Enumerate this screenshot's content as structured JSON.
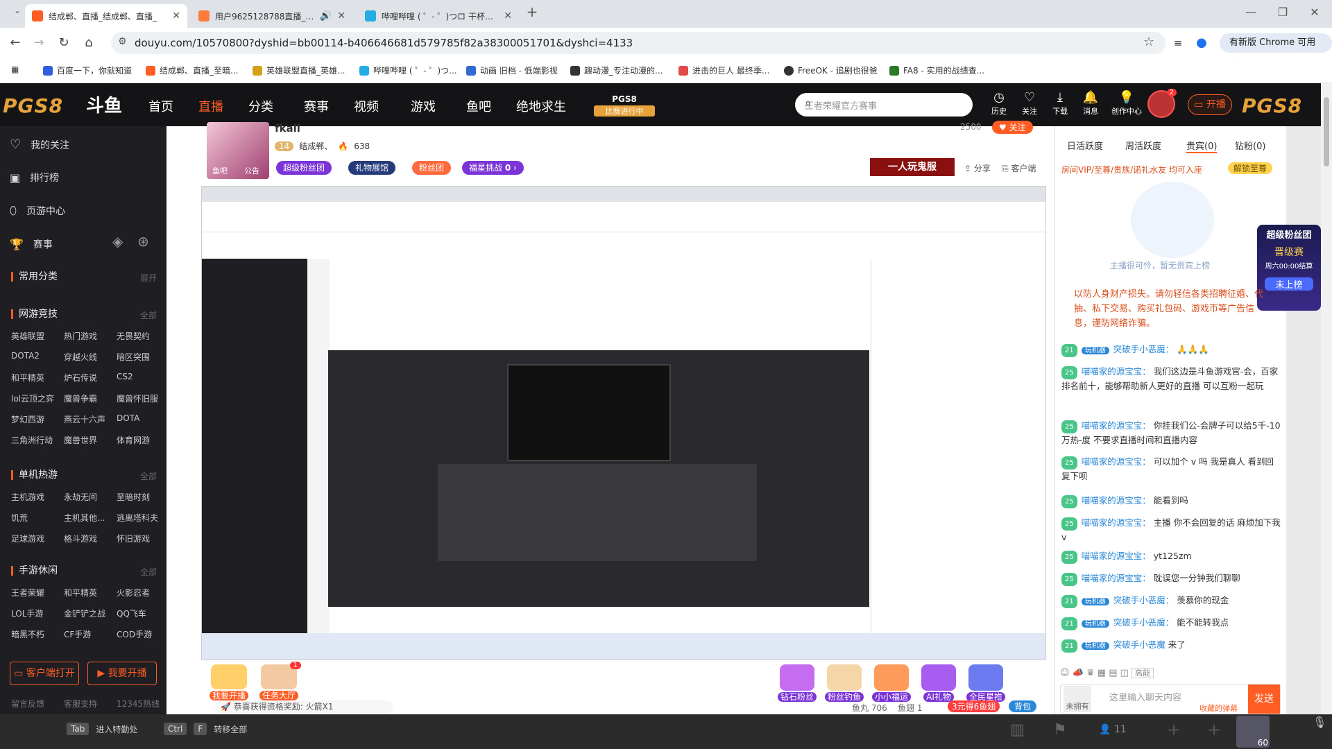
{
  "browser": {
    "tabs": [
      {
        "title": "结成郸、直播_结成郸、直播_",
        "active": true
      },
      {
        "title": "用户9625128788直播_用户",
        "active": false
      },
      {
        "title": "哔哩哔哩 ( ゜- ゜)つロ 干杯~-bi",
        "active": false
      }
    ],
    "new_tab": "+",
    "url": "douyu.com/10570800?dyshid=bb00114-b406646681d579785f82a38300051701&dyshci=4133",
    "chrome_available": "有新版 Chrome 可用",
    "bookmarks": [
      "百度一下，你就知道",
      "结成郸、直播_至暗...",
      "英雄联盟直播_英雄...",
      "哔哩哔哩 ( ゜- ゜)つ...",
      "动画 旧档 - 低端影视",
      "趣动漫_专注动漫的...",
      "进击的巨人 最终季...",
      "FreeOK - 追剧也很爸",
      "FA8 - 实用的战绩查..."
    ]
  },
  "site": {
    "brand_left": "PGS8",
    "brand_right": "PGS8",
    "logo": "斗鱼",
    "nav": [
      "首页",
      "直播",
      "分类",
      "赛事",
      "视频",
      "游戏",
      "鱼吧",
      "绝地求生"
    ],
    "nav_active": "直播",
    "event_badge_top": "PGS8",
    "event_badge_bottom": "比赛进行中",
    "search_placeholder": "王者荣耀官方赛事",
    "header_icons": [
      "历史",
      "关注",
      "下载",
      "消息",
      "创作中心"
    ],
    "start_stream": "开播",
    "avatar_badge": "2"
  },
  "sidebar": {
    "top_items": [
      "我的关注",
      "排行榜",
      "页游中心",
      "赛事"
    ],
    "common_label": "常用分类",
    "expand": "展开",
    "all": "全部",
    "sections": [
      {
        "title": "网游竞技",
        "games": [
          "英雄联盟",
          "热门游戏",
          "无畏契约",
          "DOTA2",
          "穿越火线",
          "暗区突围",
          "和平精英",
          "炉石传说",
          "CS2",
          "lol云顶之弈",
          "魔兽争霸",
          "魔兽怀旧服",
          "梦幻西游",
          "燕云十六声",
          "DOTA",
          "三角洲行动",
          "魔兽世界",
          "体育网游"
        ]
      },
      {
        "title": "单机热游",
        "games": [
          "主机游戏",
          "永劫无间",
          "至暗时刻",
          "饥荒",
          "主机其他...",
          "逃离塔科夫",
          "足球游戏",
          "格斗游戏",
          "怀旧游戏"
        ]
      },
      {
        "title": "手游休闲",
        "games": [
          "王者荣耀",
          "和平精英",
          "火影忍者",
          "LOL手游",
          "金铲铲之战",
          "QQ飞车",
          "暗黑不朽",
          "CF手游",
          "COD手游"
        ]
      }
    ],
    "client_open": "客户端打开",
    "start_live": "我要开播",
    "footer": [
      "留言反馈",
      "客服支持",
      "12345热线"
    ]
  },
  "room": {
    "streamer": "fkall",
    "level_badge": "14",
    "nickname": "结成郸、",
    "hot": "638",
    "followers": "2500",
    "follow": "关注",
    "tabs": [
      "超级粉丝团",
      "礼物展馆",
      "粉丝团",
      "福星挑战"
    ],
    "challenge_count": "0",
    "avatar_labels": [
      "鱼吧",
      "公告"
    ],
    "share": "分享",
    "client": "客户端",
    "banner": "一人玩鬼服"
  },
  "rank_tabs": [
    "日活跃度",
    "周活跃度",
    "贵宾(0)",
    "钻粉(0)"
  ],
  "vip_notice": "房间VIP/至尊/贵族/诺礼水友 均可入座",
  "unlock": "解锁至尊",
  "empty_seat": "主播很可怜，暂无贵宾上榜",
  "superfan": {
    "title": "超级粉丝团",
    "sub": "晋级赛",
    "timer": "周六00:00结算",
    "cta": "未上榜"
  },
  "chat_notice": "以防人身财产损失。请勿轻信各类招聘征婚、代抽、私下交易、购买礼包码、游戏币等广告信息，谨防网络诈骗。",
  "chat": [
    {
      "lv": "21",
      "badge": "玩机器",
      "name": "突破手小恶魔：",
      "text": "🙏🙏🙏"
    },
    {
      "lv": "25",
      "badge": "",
      "name": "喵喵家的源宝宝：",
      "text": "我们这边是斗鱼游戏官-会，百家排名前十，能够帮助新人更好的直播 可以互粉一起玩"
    },
    {
      "lv": "25",
      "badge": "",
      "name": "喵喵家的源宝宝：",
      "text": "你挂我们公-会牌子可以给5千-10万热-度 不要求直播时间和直播内容"
    },
    {
      "lv": "25",
      "badge": "",
      "name": "喵喵家的源宝宝：",
      "text": "可以加个 v 吗 我是真人 看到回复下呗"
    },
    {
      "lv": "25",
      "badge": "",
      "name": "喵喵家的源宝宝：",
      "text": "能看到吗"
    },
    {
      "lv": "25",
      "badge": "",
      "name": "喵喵家的源宝宝：",
      "text": "主播 你不会回复的话 麻烦加下我 v"
    },
    {
      "lv": "25",
      "badge": "",
      "name": "喵喵家的源宝宝：",
      "text": "yt125zm"
    },
    {
      "lv": "25",
      "badge": "",
      "name": "喵喵家的源宝宝：",
      "text": "耽误您一分钟我们聊聊"
    },
    {
      "lv": "21",
      "badge": "玩机器",
      "name": "突破手小恶魔：",
      "text": "羡慕你的现金"
    },
    {
      "lv": "21",
      "badge": "玩机器",
      "name": "突破手小恶魔：",
      "text": "能不能转我点"
    },
    {
      "lv": "21",
      "badge": "玩机器",
      "name": "突破手小恶魔",
      "text": "来了"
    }
  ],
  "chat_input": {
    "placeholder": "这里输入聊天内容",
    "send": "发送",
    "not_owned": "未拥有",
    "collect": "收藏的弹幕",
    "hd": "高能"
  },
  "bottom": {
    "start": "我要开播",
    "task": "任务大厅",
    "task_badge": "1",
    "gifts": [
      "钻石粉丝",
      "粉丝钓鱼",
      "小小福运",
      "AI礼物",
      "全民星推"
    ],
    "reward_text": "恭喜获得资格奖励: 火箭X1",
    "fish_balls": "鱼丸 706",
    "fish_ticket": "鱼翅 1",
    "recharge": "3元得6鱼翅",
    "backpack": "背包"
  },
  "taskbar": {
    "tab_hint": "进入特勤处",
    "ctrl_hint": "转移全部",
    "count": "11",
    "avatar_num": "60"
  }
}
